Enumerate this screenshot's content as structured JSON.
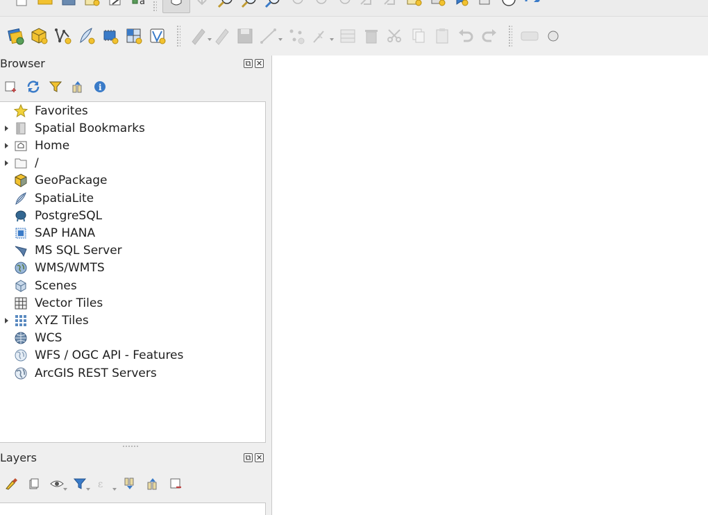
{
  "browser_panel": {
    "title": "Browser",
    "tools": [
      "add-selected-layers-icon",
      "refresh-icon",
      "filter-icon",
      "collapse-all-icon",
      "properties-icon"
    ],
    "items": [
      {
        "label": "Favorites",
        "icon": "star-icon",
        "expandable": false
      },
      {
        "label": "Spatial Bookmarks",
        "icon": "bookmark-icon",
        "expandable": true
      },
      {
        "label": "Home",
        "icon": "home-folder-icon",
        "expandable": true
      },
      {
        "label": "/",
        "icon": "folder-icon",
        "expandable": true
      },
      {
        "label": "GeoPackage",
        "icon": "geopackage-icon",
        "expandable": false
      },
      {
        "label": "SpatiaLite",
        "icon": "spatialite-icon",
        "expandable": false
      },
      {
        "label": "PostgreSQL",
        "icon": "postgresql-icon",
        "expandable": false
      },
      {
        "label": "SAP HANA",
        "icon": "sap-hana-icon",
        "expandable": false
      },
      {
        "label": "MS SQL Server",
        "icon": "mssql-icon",
        "expandable": false
      },
      {
        "label": "WMS/WMTS",
        "icon": "wms-globe-icon",
        "expandable": false
      },
      {
        "label": "Scenes",
        "icon": "scenes-cube-icon",
        "expandable": false
      },
      {
        "label": "Vector Tiles",
        "icon": "vector-tiles-icon",
        "expandable": false
      },
      {
        "label": "XYZ Tiles",
        "icon": "xyz-tiles-icon",
        "expandable": true
      },
      {
        "label": "WCS",
        "icon": "wcs-globe-icon",
        "expandable": false
      },
      {
        "label": "WFS / OGC API - Features",
        "icon": "wfs-globe-icon",
        "expandable": false
      },
      {
        "label": "ArcGIS REST Servers",
        "icon": "arcgis-globe-icon",
        "expandable": false
      }
    ]
  },
  "layers_panel": {
    "title": "Layers",
    "tools": [
      "open-styling-icon",
      "add-group-icon",
      "manage-visibility-icon",
      "filter-legend-icon",
      "filter-expression-icon",
      "expand-all-icon",
      "collapse-all-icon",
      "remove-layer-icon"
    ]
  },
  "toolbar_top": {
    "partial_text": "a"
  },
  "colors": {
    "panel_bg": "#efefef",
    "tree_bg": "#ffffff",
    "accent_blue": "#3a7bc8",
    "accent_yellow": "#f2c230"
  }
}
